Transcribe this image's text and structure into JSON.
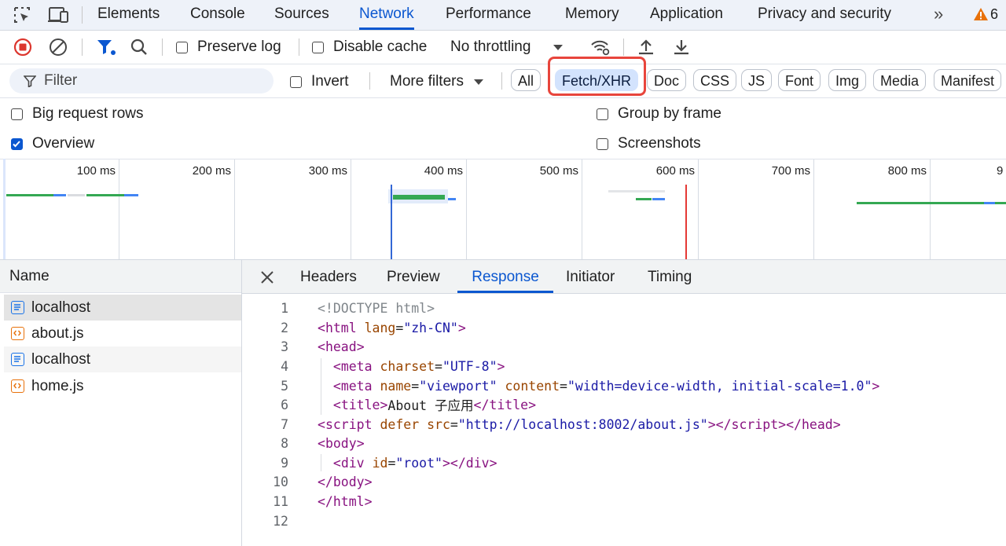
{
  "tabs": [
    "Elements",
    "Console",
    "Sources",
    "Network",
    "Performance",
    "Memory",
    "Application",
    "Privacy and security"
  ],
  "active_tab": "Network",
  "more_tabs_label": "»",
  "warning_count": "6",
  "toolbar": {
    "preserve_log": "Preserve log",
    "disable_cache": "Disable cache",
    "throttling": "No throttling"
  },
  "filter": {
    "placeholder": "Filter",
    "invert": "Invert",
    "more_filters": "More filters",
    "types": [
      "All",
      "Fetch/XHR",
      "Doc",
      "CSS",
      "JS",
      "Font",
      "Img",
      "Media",
      "Manifest"
    ],
    "selected_type": "Fetch/XHR"
  },
  "options": {
    "big_request_rows": "Big request rows",
    "group_by_frame": "Group by frame",
    "overview": "Overview",
    "screenshots": "Screenshots",
    "overview_checked": true
  },
  "timeline_ticks": [
    "100 ms",
    "200 ms",
    "300 ms",
    "400 ms",
    "500 ms",
    "600 ms",
    "700 ms",
    "800 ms",
    "9"
  ],
  "requests": {
    "header": "Name",
    "items": [
      {
        "name": "localhost",
        "type": "document",
        "selected": true
      },
      {
        "name": "about.js",
        "type": "script"
      },
      {
        "name": "localhost",
        "type": "document"
      },
      {
        "name": "home.js",
        "type": "script"
      }
    ]
  },
  "detail_tabs": [
    "Headers",
    "Preview",
    "Response",
    "Initiator",
    "Timing"
  ],
  "active_detail_tab": "Response",
  "colors": {
    "accent": "#0b57d0",
    "highlight_box": "#e8453c",
    "warning": "#e8710a"
  },
  "response_lines": [
    {
      "n": "1"
    },
    {
      "n": "2"
    },
    {
      "n": "3"
    },
    {
      "n": "4"
    },
    {
      "n": "5"
    },
    {
      "n": "6"
    },
    {
      "n": "7"
    },
    {
      "n": "8"
    },
    {
      "n": "9"
    },
    {
      "n": "10"
    },
    {
      "n": "11"
    },
    {
      "n": "12"
    }
  ],
  "code": {
    "l1": "<!DOCTYPE html>",
    "html_open": "html",
    "lang_attr": "lang",
    "lang_val": "\"zh-CN\"",
    "head_open": "head",
    "meta": "meta",
    "charset_attr": "charset",
    "charset_val": "\"UTF-8\"",
    "name_attr": "name",
    "name_val": "\"viewport\"",
    "content_attr": "content",
    "content_val": "\"width=device-width, initial-scale=1.0\"",
    "title_tag": "title",
    "title_text": "About 子应用",
    "script_tag": "script",
    "defer_attr": "defer",
    "src_attr": "src",
    "src_val": "\"http://localhost:8002/about.js\"",
    "head_close": "head",
    "body_tag": "body",
    "div_tag": "div",
    "id_attr": "id",
    "id_val": "\"root\""
  }
}
